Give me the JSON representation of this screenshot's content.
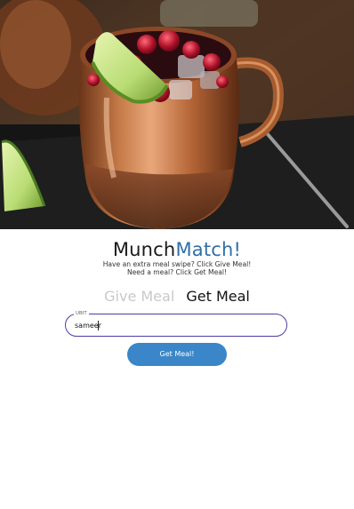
{
  "hero": {
    "image": "copper-mug-cranberry-apple-drink"
  },
  "brand": {
    "part1": "Munch",
    "part2": "Match!"
  },
  "tagline": {
    "line1": "Have an extra meal swipe? Click Give Meal!",
    "line2": "Need a meal? Click Get Meal!"
  },
  "tabs": {
    "give": "Give Meal",
    "get": "Get Meal",
    "active": "get"
  },
  "form": {
    "ubit_label": "UBIT",
    "ubit_value": "sameer",
    "submit_label": "Get Meal!"
  },
  "colors": {
    "brand_accent": "#2f6fa8",
    "button": "#3a86c8",
    "input_border": "#4a3fa5",
    "inactive_tab": "#c9c9c9"
  }
}
